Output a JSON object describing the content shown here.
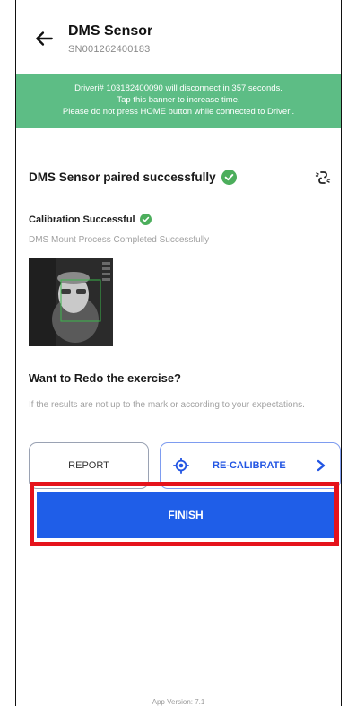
{
  "header": {
    "title": "DMS Sensor",
    "serial": "SN001262400183"
  },
  "banner": {
    "line1": "Driveri# 103182400090 will disconnect in 357 seconds.",
    "line2": "Tap this banner to increase time.",
    "line3": "Please do not press HOME button while connected to Driveri."
  },
  "status": {
    "paired_text": "DMS Sensor paired successfully",
    "calibration_title": "Calibration Successful",
    "calibration_subtitle": "DMS Mount Process Completed Successfully"
  },
  "redo": {
    "title": "Want to Redo the exercise?",
    "description": "If the results are not up to the mark or according to your expectations."
  },
  "buttons": {
    "report": "REPORT",
    "recalibrate": "RE-CALIBRATE",
    "finish": "FINISH"
  },
  "footer": {
    "version": "App Version: 7.1"
  },
  "colors": {
    "banner": "#5dbd85",
    "success": "#4cae5c",
    "primary": "#1f5ee8",
    "highlight": "#e5131c"
  },
  "icons": [
    "back-arrow-icon",
    "check-circle-icon",
    "unlink-icon",
    "target-icon",
    "chevron-right-icon"
  ]
}
